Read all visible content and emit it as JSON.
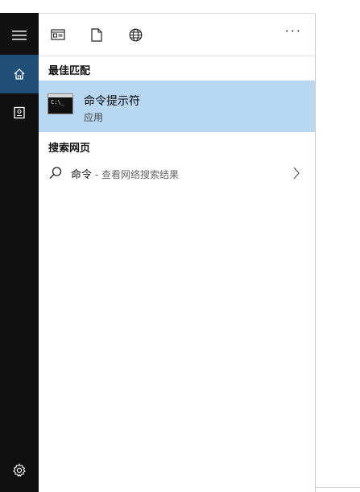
{
  "toolbar": {
    "more_label": "···"
  },
  "sections": {
    "best_match": "最佳匹配",
    "web_search": "搜索网页"
  },
  "best_match_item": {
    "title": "命令提示符",
    "subtitle": "应用",
    "icon": "command-prompt-icon",
    "icon_text": "C:\\_"
  },
  "web_search_item": {
    "query": "命令",
    "hint": " - 查看网络搜索结果"
  },
  "colors": {
    "rail": "#111111",
    "rail_active": "#1f4e79",
    "highlight": "#b8d8f2"
  }
}
